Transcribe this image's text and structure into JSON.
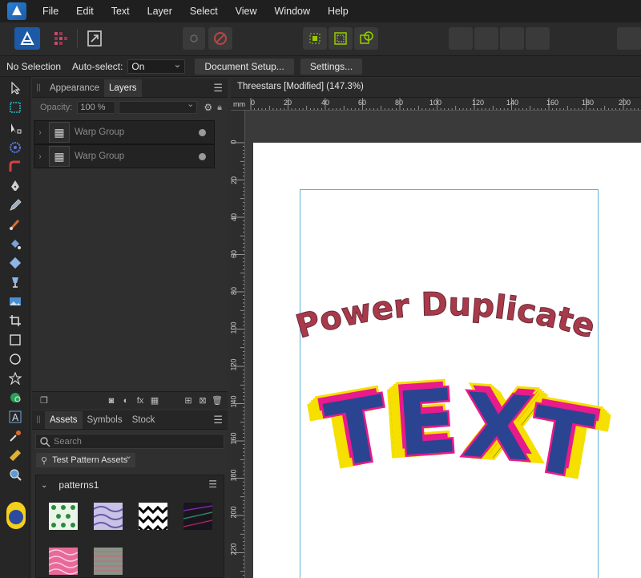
{
  "menubar": {
    "items": [
      "File",
      "Edit",
      "Text",
      "Layer",
      "Select",
      "View",
      "Window",
      "Help"
    ]
  },
  "contextbar": {
    "selection": "No Selection",
    "auto_select_label": "Auto-select:",
    "auto_select_value": "On",
    "document_setup": "Document Setup...",
    "settings": "Settings..."
  },
  "layers_panel": {
    "tabs": [
      "Appearance",
      "Layers"
    ],
    "active_tab": "Layers",
    "opacity_label": "Opacity:",
    "opacity_value": "100 %",
    "layers": [
      {
        "name": "Warp Group"
      },
      {
        "name": "Warp Group"
      }
    ]
  },
  "assets_panel": {
    "tabs": [
      "Assets",
      "Symbols",
      "Stock"
    ],
    "active_tab": "Assets",
    "search_placeholder": "Search",
    "category": "Test Pattern Assets",
    "section_name": "patterns1"
  },
  "document": {
    "tab_title": "Threestars [Modified] (147.3%)",
    "ruler_unit": "mm",
    "ruler_h_labels": [
      "0",
      "20",
      "40",
      "60",
      "80",
      "100",
      "120",
      "140",
      "160",
      "180",
      "200"
    ],
    "ruler_v_labels": [
      "0",
      "20",
      "40",
      "60",
      "80",
      "100",
      "120",
      "140",
      "160",
      "180",
      "200",
      "220"
    ]
  },
  "artwork": {
    "headline": "Power Duplicate",
    "main_text": "TEXT",
    "headline_color": "#a83a4a",
    "text_fill": "#2b4491",
    "outline_colors": [
      "#f5e000",
      "#f08a1e",
      "#e43b2b",
      "#e81a8c",
      "#444444"
    ]
  },
  "colors": {
    "accent": "#2a7fd6",
    "guide": "#5fb1d6"
  }
}
